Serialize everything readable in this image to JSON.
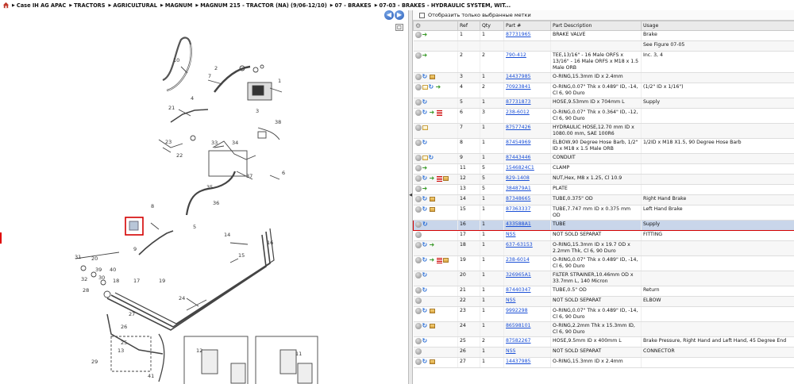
{
  "breadcrumb": {
    "home_icon": "home-icon",
    "items": [
      {
        "label": "Case IH AG APAC"
      },
      {
        "label": "TRACTORS"
      },
      {
        "label": "AGRICULTURAL"
      },
      {
        "label": "MAGNUM"
      },
      {
        "label": "MAGNUM 215 - TRACTOR (NA) (9/06-12/10)"
      },
      {
        "label": "07 - BRAKES"
      },
      {
        "label": "07-03 - BRAKES - HYDRAULIC SYSTEM, WIT..."
      }
    ]
  },
  "nav": {
    "prev_icon": "arrow-left-icon",
    "next_icon": "arrow-right-icon",
    "toggle_label": "□"
  },
  "filter": {
    "label": "Отобразить только выбранные метки",
    "checked": false
  },
  "table": {
    "headers": [
      "",
      "Ref",
      "Qty",
      "Part #",
      "Part Description",
      "Usage"
    ],
    "rows": [
      {
        "ref": "1",
        "qty": "1",
        "part": "87731965",
        "desc": "BRAKE VALVE",
        "usage": "Brake",
        "icons": [
          "circle",
          "arrow"
        ]
      },
      {
        "ref": "",
        "qty": "",
        "part": "",
        "desc": "",
        "usage": "See Figure 07-05",
        "icons": []
      },
      {
        "ref": "2",
        "qty": "2",
        "part": "790-412",
        "desc": "TEE,13/16\" - 16 Male ORFS x 13/16\" - 16 Male ORFS x M18 x 1.5 Male ORB",
        "usage": "Inc. 3, 4",
        "icons": [
          "circle",
          "arrow"
        ]
      },
      {
        "ref": "3",
        "qty": "1",
        "part": "14437985",
        "desc": "O-RING,15.3mm ID x 2.4mm",
        "usage": "",
        "icons": [
          "circle",
          "rot",
          "box"
        ]
      },
      {
        "ref": "4",
        "qty": "2",
        "part": "70923841",
        "desc": "O-RING,0.07\" Thk x 0.489\" ID, -14, Cl 6, 90 Duro",
        "usage": "(1/2\" ID x 1/16\")",
        "icons": [
          "circle",
          "note",
          "rot",
          "arrow"
        ]
      },
      {
        "ref": "5",
        "qty": "1",
        "part": "87731873",
        "desc": "HOSE,9.53mm ID x 704mm L",
        "usage": "Supply",
        "icons": [
          "circle",
          "rot"
        ]
      },
      {
        "ref": "6",
        "qty": "3",
        "part": "238-6012",
        "desc": "O-RING,0.07\" Thk x 0.364\" ID, -12, Cl 6, 90 Duro",
        "usage": "",
        "icons": [
          "circle",
          "rot",
          "arrow",
          "stop"
        ]
      },
      {
        "ref": "7",
        "qty": "1",
        "part": "87577426",
        "desc": "HYDRAULIC HOSE,12.70 mm ID x 1080.00 mm, SAE 100R6",
        "usage": "",
        "icons": [
          "circle",
          "note"
        ]
      },
      {
        "ref": "8",
        "qty": "1",
        "part": "87454969",
        "desc": "ELBOW,90 Degree Hose Barb, 1/2\" ID x M18 x 1.5 Male ORB",
        "usage": "1/2ID x M18 X1.5, 90 Degree Hose Barb",
        "icons": [
          "circle",
          "rot"
        ]
      },
      {
        "ref": "9",
        "qty": "1",
        "part": "87443446",
        "desc": "CONDUIT",
        "usage": "",
        "icons": [
          "circle",
          "note",
          "rot"
        ]
      },
      {
        "ref": "11",
        "qty": "5",
        "part": "1546824C1",
        "desc": "CLAMP",
        "usage": "",
        "icons": [
          "circle",
          "arrow"
        ]
      },
      {
        "ref": "12",
        "qty": "5",
        "part": "829-1408",
        "desc": "NUT,Hex, M8 x 1.25, Cl 10.9",
        "usage": "",
        "icons": [
          "circle",
          "rot",
          "arrow",
          "stop",
          "box"
        ]
      },
      {
        "ref": "13",
        "qty": "5",
        "part": "384879A1",
        "desc": "PLATE",
        "usage": "",
        "icons": [
          "circle",
          "arrow"
        ]
      },
      {
        "ref": "14",
        "qty": "1",
        "part": "87348665",
        "desc": "TUBE,0.375\" OD",
        "usage": "Right Hand Brake",
        "icons": [
          "circle",
          "rot",
          "box"
        ]
      },
      {
        "ref": "15",
        "qty": "1",
        "part": "87363337",
        "desc": "TUBE,7.747 mm ID x 0.375 mm OD",
        "usage": "Left Hand Brake",
        "icons": [
          "circle",
          "rot",
          "box"
        ]
      },
      {
        "ref": "16",
        "qty": "1",
        "part": "433588A1",
        "desc": "TUBE",
        "usage": "Supply",
        "icons": [
          "circle",
          "rot"
        ],
        "selected": true
      },
      {
        "ref": "17",
        "qty": "1",
        "part": "NSS",
        "desc": "NOT SOLD SEPARAT",
        "usage": "FITTING",
        "icons": [
          "circle"
        ]
      },
      {
        "ref": "18",
        "qty": "1",
        "part": "637-63153",
        "desc": "O-RING,15.3mm ID x 19.7 OD x 2.2mm Thk, Cl 6, 90 Duro",
        "usage": "",
        "icons": [
          "circle",
          "rot",
          "arrow"
        ]
      },
      {
        "ref": "19",
        "qty": "1",
        "part": "238-6014",
        "desc": "O-RING,0.07\" Thk x 0.489\" ID, -14, Cl 6, 90 Duro",
        "usage": "",
        "icons": [
          "circle",
          "rot",
          "arrow",
          "stop",
          "box"
        ]
      },
      {
        "ref": "20",
        "qty": "1",
        "part": "326965A1",
        "desc": "FILTER STRAINER,10.46mm OD x 33.7mm L, 140 Micron",
        "usage": "",
        "icons": [
          "circle",
          "rot"
        ]
      },
      {
        "ref": "21",
        "qty": "1",
        "part": "87440347",
        "desc": "TUBE,0.5\" OD",
        "usage": "Return",
        "icons": [
          "circle",
          "rot"
        ]
      },
      {
        "ref": "22",
        "qty": "1",
        "part": "NSS",
        "desc": "NOT SOLD SEPARAT",
        "usage": "ELBOW",
        "icons": [
          "circle"
        ]
      },
      {
        "ref": "23",
        "qty": "1",
        "part": "9992298",
        "desc": "O-RING,0.07\" Thk x 0.489\" ID, -14, Cl 6, 90 Duro",
        "usage": "",
        "icons": [
          "circle",
          "rot",
          "box"
        ]
      },
      {
        "ref": "24",
        "qty": "1",
        "part": "86598101",
        "desc": "O-RING,2.2mm Thk x 15.3mm ID, Cl 6, 90 Duro",
        "usage": "",
        "icons": [
          "circle",
          "rot",
          "box"
        ]
      },
      {
        "ref": "25",
        "qty": "2",
        "part": "87582267",
        "desc": "HOSE,9.5mm ID x 400mm L",
        "usage": "Brake Pressure, Right Hand and Left Hand, 45 Degree End",
        "icons": [
          "circle",
          "rot"
        ]
      },
      {
        "ref": "26",
        "qty": "1",
        "part": "NSS",
        "desc": "NOT SOLD SEPARAT",
        "usage": "CONNECTOR",
        "icons": [
          "circle"
        ]
      },
      {
        "ref": "27",
        "qty": "1",
        "part": "14437985",
        "desc": "O-RING,15.3mm ID x 2.4mm",
        "usage": "",
        "icons": [
          "circle",
          "rot",
          "box"
        ]
      }
    ]
  },
  "diagram_labels": [
    "1",
    "2",
    "3",
    "4",
    "5",
    "6",
    "7",
    "8",
    "9",
    "10",
    "11",
    "12",
    "13",
    "14",
    "15",
    "16",
    "17",
    "18",
    "19",
    "20",
    "21",
    "22",
    "23",
    "24",
    "25",
    "26",
    "27",
    "28",
    "29",
    "30",
    "31",
    "32",
    "33",
    "34",
    "35",
    "36",
    "37",
    "38",
    "39",
    "40",
    "41"
  ],
  "colors": {
    "link": "#1a4fd6",
    "selection": "#d40000",
    "selected_row": "#c9d6ea"
  }
}
